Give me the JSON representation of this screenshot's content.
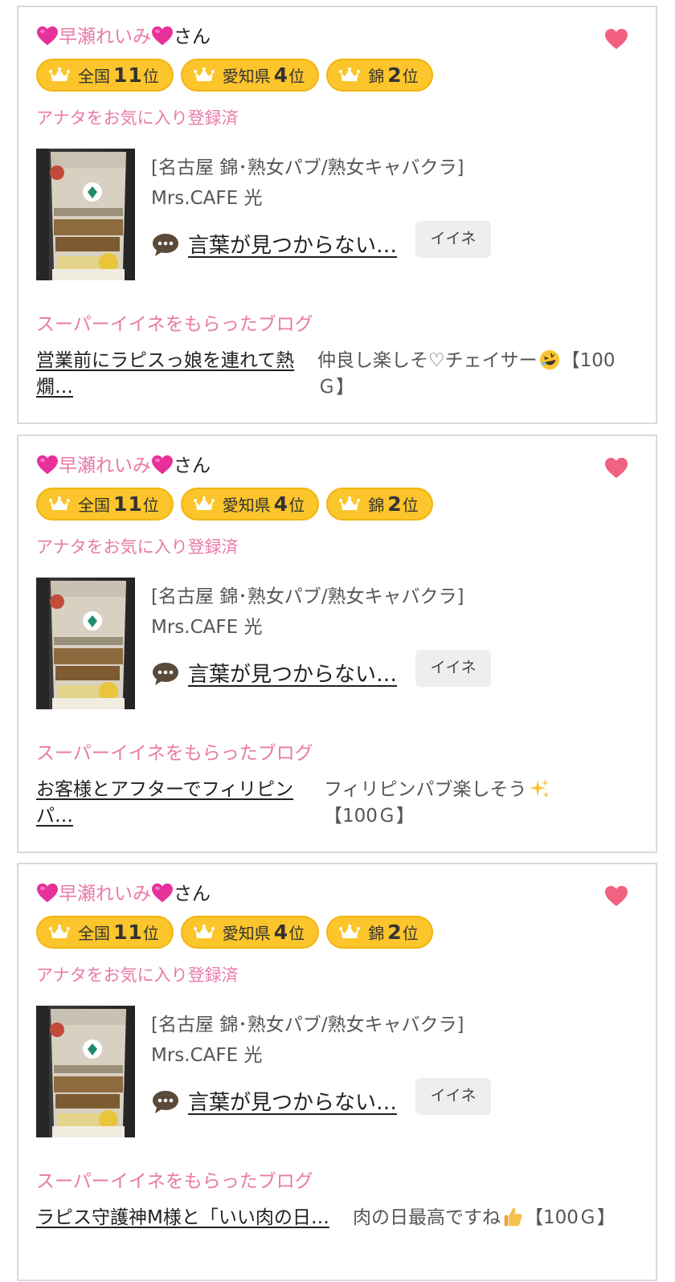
{
  "cards": [
    {
      "name_pre": "早瀬れいみ",
      "name_suffix": "さん",
      "badges": [
        {
          "label": "全国",
          "num": "11",
          "unit": "位"
        },
        {
          "label": "愛知県",
          "num": "4",
          "unit": "位"
        },
        {
          "label": "錦",
          "num": "2",
          "unit": "位"
        }
      ],
      "favorite_note": "アナタをお気に入り登録済",
      "shop_category": "[名古屋 錦･熟女パブ/熟女キャバクラ]",
      "shop_name": "Mrs.CAFE 光",
      "comment_link": "言葉が見つからない…",
      "iine_label": "イイネ",
      "blog_heading": "スーパーイイネをもらったブログ",
      "blog_title": "営業前にラピスっ娘を連れて熱燗…",
      "blog_desc_pre": "仲良し楽しそ♡チェイサー",
      "blog_desc_post": "【100Ｇ】",
      "blog_emoji": "rofl-icon"
    },
    {
      "name_pre": "早瀬れいみ",
      "name_suffix": "さん",
      "badges": [
        {
          "label": "全国",
          "num": "11",
          "unit": "位"
        },
        {
          "label": "愛知県",
          "num": "4",
          "unit": "位"
        },
        {
          "label": "錦",
          "num": "2",
          "unit": "位"
        }
      ],
      "favorite_note": "アナタをお気に入り登録済",
      "shop_category": "[名古屋 錦･熟女パブ/熟女キャバクラ]",
      "shop_name": "Mrs.CAFE 光",
      "comment_link": "言葉が見つからない…",
      "iine_label": "イイネ",
      "blog_heading": "スーパーイイネをもらったブログ",
      "blog_title": "お客様とアフターでフィリピンパ…",
      "blog_desc_pre": "フィリピンパブ楽しそう",
      "blog_desc_post": "【100Ｇ】",
      "blog_emoji": "sparkles-icon"
    },
    {
      "name_pre": "早瀬れいみ",
      "name_suffix": "さん",
      "badges": [
        {
          "label": "全国",
          "num": "11",
          "unit": "位"
        },
        {
          "label": "愛知県",
          "num": "4",
          "unit": "位"
        },
        {
          "label": "錦",
          "num": "2",
          "unit": "位"
        }
      ],
      "favorite_note": "アナタをお気に入り登録済",
      "shop_category": "[名古屋 錦･熟女パブ/熟女キャバクラ]",
      "shop_name": "Mrs.CAFE 光",
      "comment_link": "言葉が見つからない…",
      "iine_label": "イイネ",
      "blog_heading": "スーパーイイネをもらったブログ",
      "blog_title": "ラピス守護神M様と「いい肉の日…",
      "blog_desc_pre": "肉の日最高ですね",
      "blog_desc_post": "【100Ｇ】",
      "blog_emoji": "thumbs-up-icon"
    }
  ],
  "colors": {
    "accent_pink": "#e87aa8",
    "heart": "#f2617f",
    "badge_yellow": "#fbc52b"
  }
}
